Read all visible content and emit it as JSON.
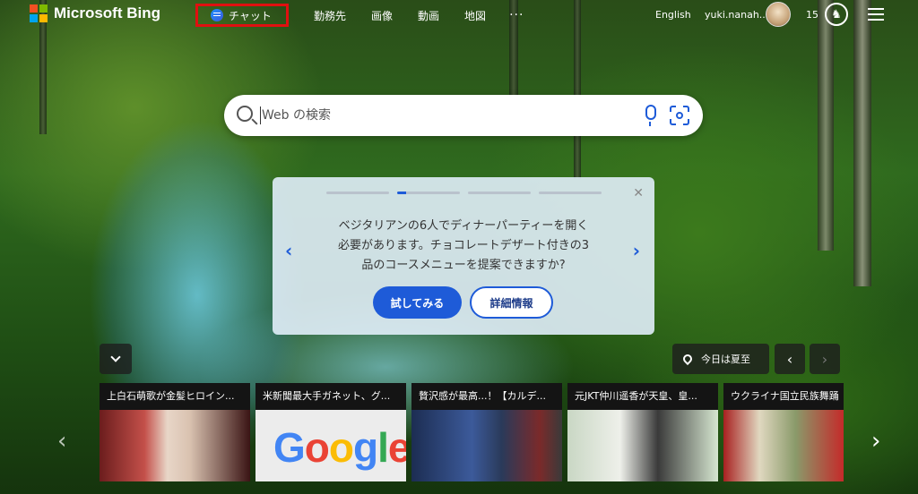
{
  "header": {
    "logo_text": "Microsoft Bing",
    "nav": {
      "chat": "チャット",
      "jobs": "勤務先",
      "images": "画像",
      "videos": "動画",
      "maps": "地図",
      "more": "···"
    },
    "language": "English",
    "user_name": "yuki.nanah...",
    "points": "15",
    "colors": {
      "highlight_border": "#e01010"
    }
  },
  "search": {
    "placeholder": "Web の検索"
  },
  "suggestion_card": {
    "text_line1": "ベジタリアンの6人でディナーパーティーを開く",
    "text_line2": "必要があります。チョコレートデザート付きの3",
    "text_line3": "品のコースメニューを提案できますか?",
    "try_button": "試してみる",
    "info_button": "詳細情報",
    "page_count": 4,
    "active_page": 2,
    "accent_color": "#1e5bd8"
  },
  "image_info": {
    "location_label": "今日は夏至"
  },
  "news": [
    {
      "title": "上白石萌歌が金髪ヒロイン..."
    },
    {
      "title": "米新聞最大手ガネット、グ...",
      "image_text": "Google"
    },
    {
      "title": "贅沢感が最高...！【カルデ..."
    },
    {
      "title": "元JKT仲川遥香が天皇、皇..."
    },
    {
      "title": "ウクライナ国立民族舞踊"
    }
  ]
}
